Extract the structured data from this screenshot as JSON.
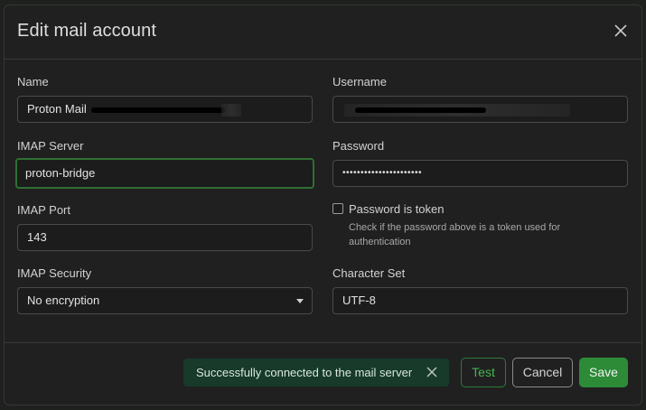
{
  "modal": {
    "title": "Edit mail account",
    "close_icon": "close-icon"
  },
  "fields": {
    "name": {
      "label": "Name",
      "value": "Proton Mail"
    },
    "username": {
      "label": "Username",
      "value": ""
    },
    "imap_server": {
      "label": "IMAP Server",
      "value": "proton-bridge"
    },
    "password": {
      "label": "Password",
      "value": "••••••••••••••••••••••"
    },
    "imap_port": {
      "label": "IMAP Port",
      "value": "143"
    },
    "password_is_token": {
      "label": "Password is token",
      "checked": false,
      "help": "Check if the password above is a token used for authentication"
    },
    "imap_security": {
      "label": "IMAP Security",
      "value": "No encryption"
    },
    "character_set": {
      "label": "Character Set",
      "value": "UTF-8"
    }
  },
  "footer": {
    "toast": {
      "message": "Successfully connected to the mail server",
      "close_icon": "close-icon"
    },
    "test_label": "Test",
    "cancel_label": "Cancel",
    "save_label": "Save"
  },
  "colors": {
    "accent": "#2d8a37",
    "toast_bg": "#173a2a",
    "focus_border": "#2f6f32"
  }
}
